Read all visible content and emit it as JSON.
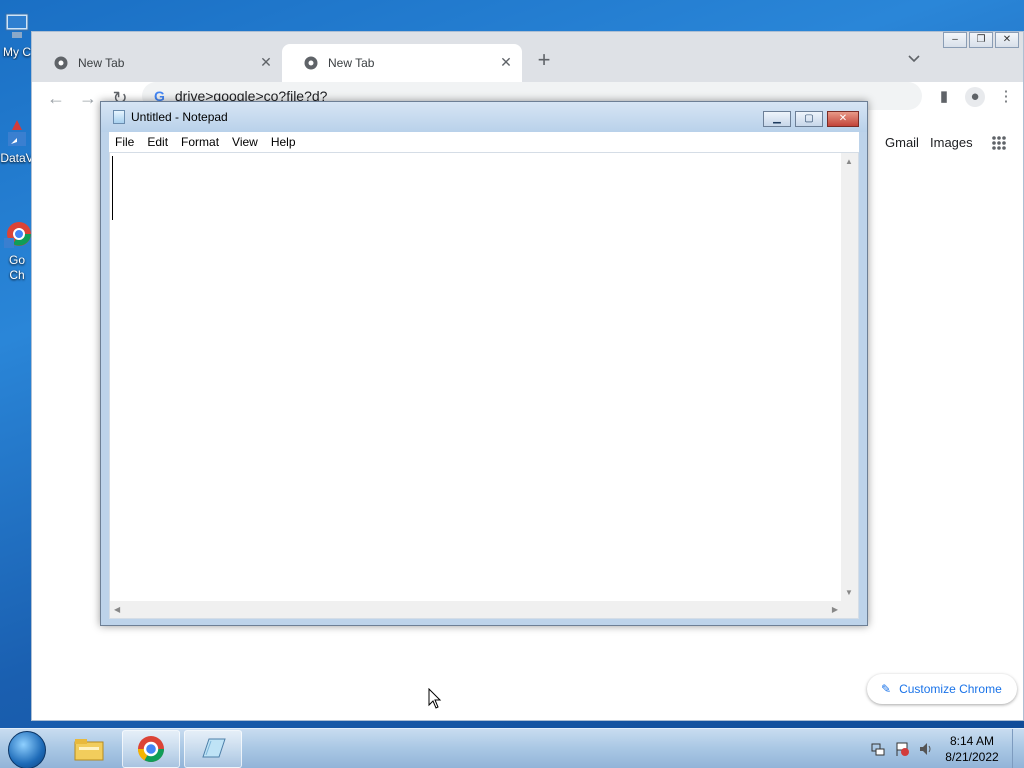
{
  "desktop": {
    "icons": [
      {
        "label": "My C",
        "icon": "computer-icon"
      },
      {
        "label": "DataV",
        "icon": "shortcut-icon"
      },
      {
        "label": "Go Ch",
        "icon": "chrome-shortcut-icon"
      }
    ]
  },
  "chrome": {
    "tabs": [
      {
        "title": "New Tab",
        "active": false
      },
      {
        "title": "New Tab",
        "active": true
      }
    ],
    "url": "drive>google>co?file?d?",
    "header_links": {
      "gmail": "Gmail",
      "images": "Images"
    },
    "customize_label": "Customize Chrome"
  },
  "notepad": {
    "title": "Untitled - Notepad",
    "menu": [
      "File",
      "Edit",
      "Format",
      "View",
      "Help"
    ],
    "content": ""
  },
  "taskbar": {
    "time": "8:14 AM",
    "date": "8/21/2022",
    "pinned": [
      "file-explorer-icon",
      "chrome-icon",
      "notepad-icon"
    ]
  },
  "colors": {
    "desktop_blue": "#1a6fc4",
    "chrome_accent": "#1a73e8",
    "notepad_frame": "#bdd3ea"
  }
}
